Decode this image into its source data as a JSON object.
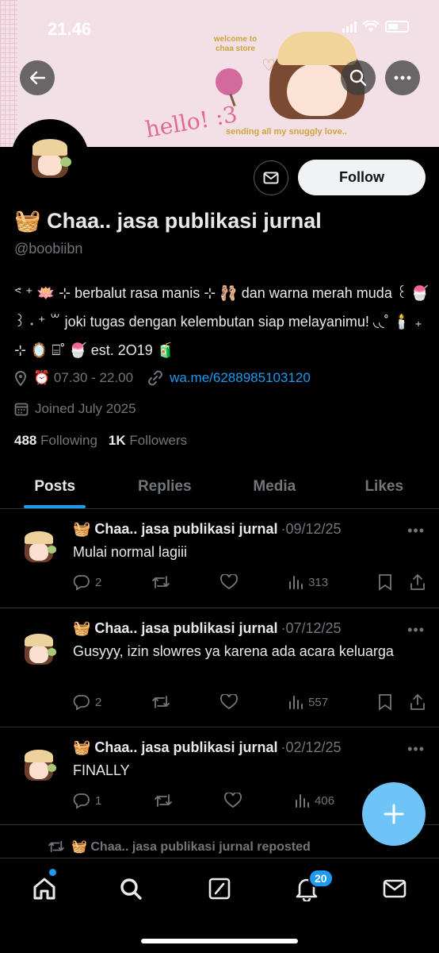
{
  "status_bar": {
    "time": "21.46"
  },
  "banner": {
    "welcome_text": "welcome to\nchaa store",
    "hello_text": "hello! :3",
    "sub_text": "sending all my snuggly love.."
  },
  "profile": {
    "name": "🧺 Chaa.. jasa publikasi jurnal",
    "handle": "@boobiibn",
    "bio": "ᕝ ⁺ 🪷 ⊹ berbalut rasa manis ⊹ 🩰 dan warna merah muda ꒰ 🍧 ꒱ ˖ ⁺ ꒳ joki tugas dengan kelembutan siap melayanimu! ◟◟˚ 🕯️ ₊ ⊹ 🪞 ⌸˚ 🍧 est. 2O19 🧃",
    "hours": "⏰ 07.30 - 22.00",
    "link": "wa.me/6288985103120",
    "joined": "Joined July 2025",
    "following_count": "488",
    "following_label": "Following",
    "followers_count": "1K",
    "followers_label": "Followers",
    "follow_label": "Follow"
  },
  "tabs": [
    {
      "label": "Posts",
      "active": true
    },
    {
      "label": "Replies",
      "active": false
    },
    {
      "label": "Media",
      "active": false
    },
    {
      "label": "Likes",
      "active": false
    }
  ],
  "posts": [
    {
      "author": "🧺 Chaa.. jasa publikasi jurnal",
      "date": "·09/12/25",
      "text": "Mulai normal lagiii",
      "replies": "2",
      "reposts": "",
      "likes": "",
      "views": "313"
    },
    {
      "author": "🧺 Chaa.. jasa publikasi jurnal",
      "date": "·07/12/25",
      "text": "Gusyyy, izin slowres ya karena ada acara keluarga",
      "replies": "2",
      "reposts": "",
      "likes": "",
      "views": "557"
    },
    {
      "author": "🧺 Chaa.. jasa publikasi jurnal",
      "date": "·02/12/25",
      "text": "FINALLY",
      "replies": "1",
      "reposts": "",
      "likes": "",
      "views": "406"
    }
  ],
  "repost_indicator": "🧺 Chaa.. jasa publikasi jurnal reposted",
  "nav": {
    "notifications_badge": "20"
  },
  "colors": {
    "accent": "#1d9bf0",
    "fab": "#6ec4f7",
    "muted": "#71767b"
  }
}
